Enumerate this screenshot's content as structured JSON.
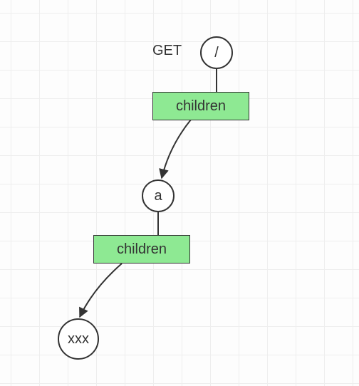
{
  "diagram": {
    "nodes": {
      "root": {
        "label": "/",
        "sideLabel": "GET"
      },
      "children1": {
        "label": "children"
      },
      "a": {
        "label": "a"
      },
      "children2": {
        "label": "children"
      },
      "xxx": {
        "label": "xxx"
      }
    }
  }
}
